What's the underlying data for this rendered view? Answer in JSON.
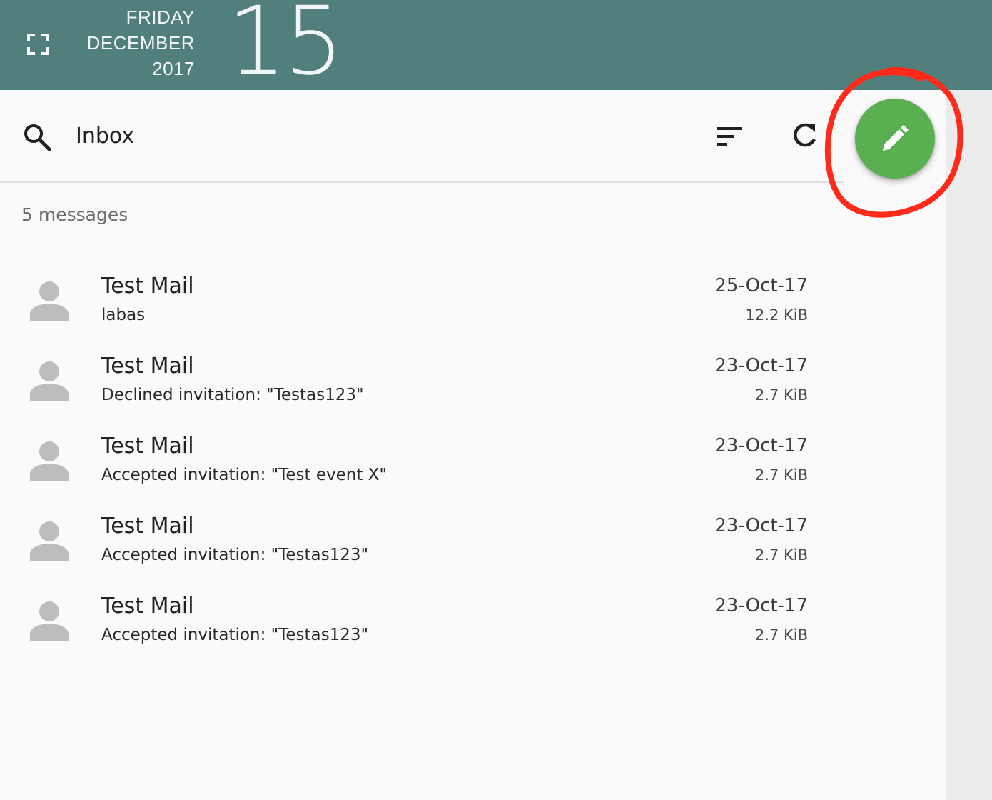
{
  "header": {
    "weekday": "FRIDAY",
    "month": "DECEMBER",
    "year": "2017",
    "day": "15",
    "color": "#507f7c"
  },
  "toolbar": {
    "search_icon": "search-icon",
    "title": "Inbox",
    "sort_icon": "sort-icon",
    "refresh_icon": "refresh-icon",
    "compose_icon": "pencil-icon",
    "compose_color": "#5aaf51"
  },
  "annotation": {
    "shape": "hand-drawn circle",
    "color": "#ff2a1a",
    "target": "compose button"
  },
  "mailbox": {
    "count_label": "5 messages",
    "messages": [
      {
        "sender": "Test Mail",
        "subject": "labas",
        "date": "25-Oct-17",
        "size": "12.2 KiB"
      },
      {
        "sender": "Test Mail",
        "subject": "Declined invitation: \"Testas123\"",
        "date": "23-Oct-17",
        "size": "2.7 KiB"
      },
      {
        "sender": "Test Mail",
        "subject": "Accepted invitation: \"Test event X\"",
        "date": "23-Oct-17",
        "size": "2.7 KiB"
      },
      {
        "sender": "Test Mail",
        "subject": "Accepted invitation: \"Testas123\"",
        "date": "23-Oct-17",
        "size": "2.7 KiB"
      },
      {
        "sender": "Test Mail",
        "subject": "Accepted invitation: \"Testas123\"",
        "date": "23-Oct-17",
        "size": "2.7 KiB"
      }
    ]
  }
}
